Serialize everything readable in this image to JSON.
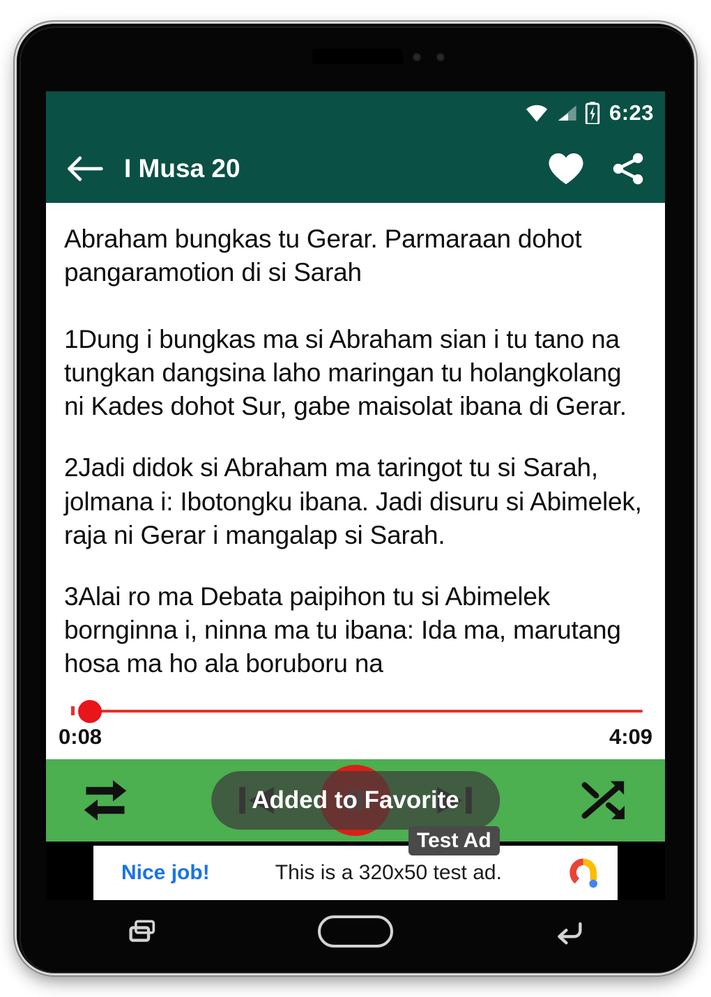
{
  "device": {
    "speaker_grille": "speaker-grille",
    "sensors": [
      "sensor-dot",
      "sensor-dot"
    ]
  },
  "status_bar": {
    "time": "6:23",
    "icons": [
      "wifi-icon",
      "cellular-signal-icon",
      "battery-charging-icon"
    ],
    "background": "#0a5045"
  },
  "app_bar": {
    "back_icon": "back-arrow-icon",
    "title": "I Musa 20",
    "favorite_icon": "heart-icon",
    "share_icon": "share-icon",
    "background": "#0a5045"
  },
  "content": {
    "heading": "Abraham bungkas tu Gerar. Parmaraan dohot pangaramotion di si Sarah",
    "verses": [
      "1Dung i bungkas ma si Abraham sian i tu tano na tungkan dangsina laho maringan tu holangkolang ni Kades dohot Sur, gabe maisolat ibana di Gerar.",
      "2Jadi didok si Abraham ma taringot tu si Sarah, jolmana i: Ibotongku ibana. Jadi disuru si Abimelek, raja ni Gerar i mangalap si Sarah.",
      "3Alai ro ma Debata paipihon tu si Abimelek bornginna i, ninna ma tu ibana: Ida ma, marutang hosa ma ho ala boruboru na"
    ]
  },
  "player": {
    "seek": {
      "current_time": "0:08",
      "total_time": "4:09",
      "progress_percent": 3,
      "accent_color": "#e8151b"
    },
    "repeat_icon": "repeat-icon",
    "previous_icon": "previous-track-icon",
    "play_pause_icon": "pause-icon",
    "next_icon": "next-track-icon",
    "shuffle_icon": "shuffle-icon",
    "background": "#4caf50",
    "toast_message": "Added to Favorite"
  },
  "ad": {
    "label": "Test Ad",
    "cta": "Nice job!",
    "body": "This is a 320x50 test ad.",
    "logo_icon": "admob-logo-icon"
  },
  "nav_bar": {
    "recents_icon": "recents-icon",
    "home_icon": "home-icon",
    "back_icon": "back-icon"
  }
}
